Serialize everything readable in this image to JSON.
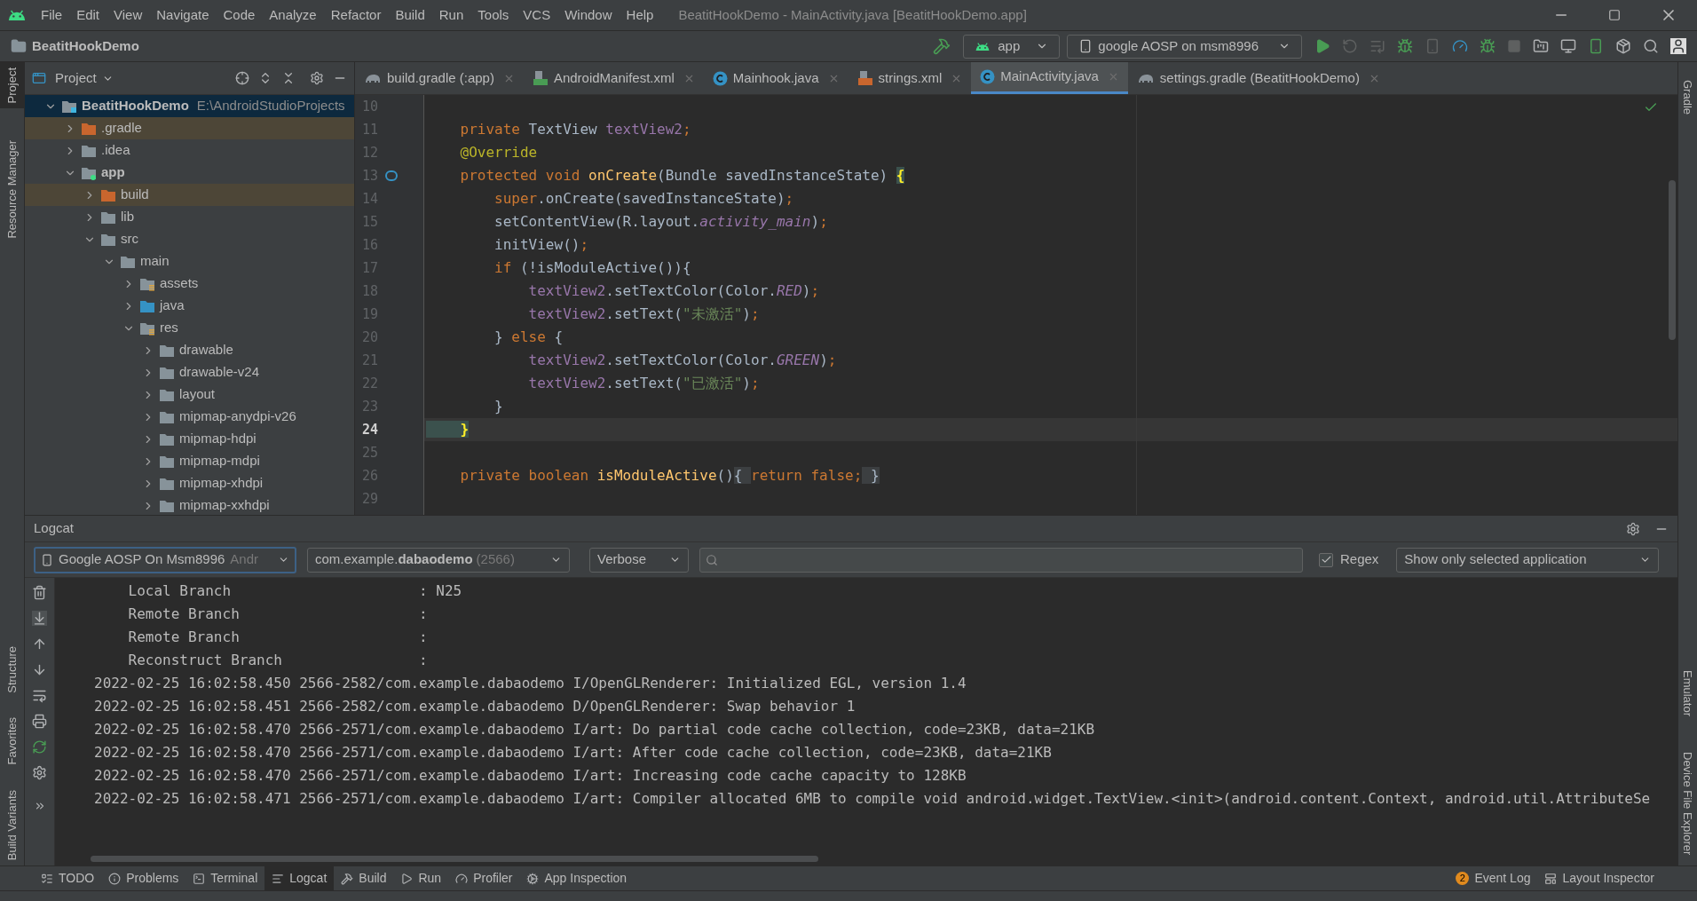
{
  "window": {
    "title": "BeatitHookDemo - MainActivity.java [BeatitHookDemo.app]"
  },
  "menu": [
    "File",
    "Edit",
    "View",
    "Navigate",
    "Code",
    "Analyze",
    "Refactor",
    "Build",
    "Run",
    "Tools",
    "VCS",
    "Window",
    "Help"
  ],
  "nav": {
    "project": "BeatitHookDemo",
    "run_config": "app",
    "device": "google AOSP on msm8996"
  },
  "left_strip": [
    {
      "label": "Project",
      "selected": true
    },
    {
      "label": "Resource Manager",
      "selected": false
    },
    {
      "label": "Structure",
      "selected": false
    },
    {
      "label": "Favorites",
      "selected": false
    },
    {
      "label": "Build Variants",
      "selected": false
    }
  ],
  "right_strip": [
    "Gradle",
    "Emulator",
    "Device File Explorer"
  ],
  "project_panel": {
    "title": "Project",
    "tree": [
      {
        "name": "BeatitHookDemo",
        "path": "E:\\AndroidStudioProjects",
        "kind": "root",
        "expanded": true,
        "selected": true,
        "children": [
          {
            "name": ".gradle",
            "kind": "excluded",
            "expanded": false,
            "selected": false
          },
          {
            "name": ".idea",
            "kind": "plain",
            "expanded": false,
            "selected": false
          },
          {
            "name": "app",
            "kind": "module",
            "expanded": true,
            "selected": false,
            "children": [
              {
                "name": "build",
                "kind": "excluded",
                "expanded": false,
                "selected": false
              },
              {
                "name": "lib",
                "kind": "plain",
                "expanded": false,
                "selected": false
              },
              {
                "name": "src",
                "kind": "plain",
                "expanded": true,
                "selected": false,
                "children": [
                  {
                    "name": "main",
                    "kind": "plain",
                    "expanded": true,
                    "selected": false,
                    "children": [
                      {
                        "name": "assets",
                        "kind": "resource",
                        "expanded": false,
                        "selected": false
                      },
                      {
                        "name": "java",
                        "kind": "source",
                        "expanded": false,
                        "selected": false
                      },
                      {
                        "name": "res",
                        "kind": "resource",
                        "expanded": true,
                        "selected": false,
                        "children": [
                          {
                            "name": "drawable",
                            "kind": "plain",
                            "expanded": false,
                            "selected": false
                          },
                          {
                            "name": "drawable-v24",
                            "kind": "plain",
                            "expanded": false,
                            "selected": false
                          },
                          {
                            "name": "layout",
                            "kind": "plain",
                            "expanded": false,
                            "selected": false
                          },
                          {
                            "name": "mipmap-anydpi-v26",
                            "kind": "plain",
                            "expanded": false,
                            "selected": false
                          },
                          {
                            "name": "mipmap-hdpi",
                            "kind": "plain",
                            "expanded": false,
                            "selected": false
                          },
                          {
                            "name": "mipmap-mdpi",
                            "kind": "plain",
                            "expanded": false,
                            "selected": false
                          },
                          {
                            "name": "mipmap-xhdpi",
                            "kind": "plain",
                            "expanded": false,
                            "selected": false
                          },
                          {
                            "name": "mipmap-xxhdpi",
                            "kind": "plain",
                            "expanded": false,
                            "selected": false
                          }
                        ]
                      }
                    ]
                  }
                ]
              }
            ]
          }
        ]
      }
    ]
  },
  "editor_tabs": [
    {
      "label": "build.gradle (:app)",
      "kind": "gradle",
      "selected": false
    },
    {
      "label": "AndroidManifest.xml",
      "kind": "manifest",
      "selected": false
    },
    {
      "label": "Mainhook.java",
      "kind": "class",
      "selected": false
    },
    {
      "label": "strings.xml",
      "kind": "xml",
      "selected": false
    },
    {
      "label": "MainActivity.java",
      "kind": "class",
      "selected": true
    },
    {
      "label": "settings.gradle (BeatitHookDemo)",
      "kind": "gradle",
      "selected": false
    }
  ],
  "code": [
    {
      "number": "10",
      "current": false
    },
    {
      "number": "11",
      "current": false,
      "tokens": [
        {
          "kind": "kw",
          "text": "    private "
        },
        {
          "kind": "plain",
          "text": "TextView "
        },
        {
          "kind": "field",
          "text": "textView2"
        },
        {
          "kind": "kw",
          "text": ";"
        }
      ]
    },
    {
      "number": "12",
      "current": false,
      "tokens": [
        {
          "kind": "anno",
          "text": "    @Override"
        }
      ]
    },
    {
      "number": "13",
      "current": false,
      "tokens": [
        {
          "kind": "kw",
          "text": "    protected void "
        },
        {
          "kind": "method",
          "text": "onCreate"
        },
        {
          "kind": "plain",
          "text": "(Bundle savedInstanceState) "
        },
        {
          "kind": "match",
          "text": "{"
        }
      ]
    },
    {
      "number": "14",
      "current": false,
      "tokens": [
        {
          "kind": "kw",
          "text": "        super"
        },
        {
          "kind": "plain",
          "text": ".onCreate(savedInstanceState)"
        },
        {
          "kind": "kw",
          "text": ";"
        }
      ]
    },
    {
      "number": "15",
      "current": false,
      "tokens": [
        {
          "kind": "plain",
          "text": "        setContentView(R.layout."
        },
        {
          "kind": "static",
          "text": "activity_main"
        },
        {
          "kind": "plain",
          "text": ")"
        },
        {
          "kind": "kw",
          "text": ";"
        }
      ]
    },
    {
      "number": "16",
      "current": false,
      "tokens": [
        {
          "kind": "plain",
          "text": "        initView()"
        },
        {
          "kind": "kw",
          "text": ";"
        }
      ]
    },
    {
      "number": "17",
      "current": false,
      "tokens": [
        {
          "kind": "kw",
          "text": "        if "
        },
        {
          "kind": "plain",
          "text": "(!isModuleActive()){"
        }
      ]
    },
    {
      "number": "18",
      "current": false,
      "tokens": [
        {
          "kind": "field",
          "text": "            textView2"
        },
        {
          "kind": "plain",
          "text": ".setTextColor(Color."
        },
        {
          "kind": "static",
          "text": "RED"
        },
        {
          "kind": "plain",
          "text": ")"
        },
        {
          "kind": "kw",
          "text": ";"
        }
      ]
    },
    {
      "number": "19",
      "current": false,
      "tokens": [
        {
          "kind": "field",
          "text": "            textView2"
        },
        {
          "kind": "plain",
          "text": ".setText("
        },
        {
          "kind": "str",
          "text": "\"未激活\""
        },
        {
          "kind": "plain",
          "text": ")"
        },
        {
          "kind": "kw",
          "text": ";"
        }
      ]
    },
    {
      "number": "20",
      "current": false,
      "tokens": [
        {
          "kind": "plain",
          "text": "        } "
        },
        {
          "kind": "kw",
          "text": "else "
        },
        {
          "kind": "plain",
          "text": "{"
        }
      ]
    },
    {
      "number": "21",
      "current": false,
      "tokens": [
        {
          "kind": "field",
          "text": "            textView2"
        },
        {
          "kind": "plain",
          "text": ".setTextColor(Color."
        },
        {
          "kind": "static",
          "text": "GREEN"
        },
        {
          "kind": "plain",
          "text": ")"
        },
        {
          "kind": "kw",
          "text": ";"
        }
      ]
    },
    {
      "number": "22",
      "current": false,
      "tokens": [
        {
          "kind": "field",
          "text": "            textView2"
        },
        {
          "kind": "plain",
          "text": ".setText("
        },
        {
          "kind": "str",
          "text": "\"已激活\""
        },
        {
          "kind": "plain",
          "text": ")"
        },
        {
          "kind": "kw",
          "text": ";"
        }
      ]
    },
    {
      "number": "23",
      "current": false,
      "tokens": [
        {
          "kind": "plain",
          "text": "        }"
        }
      ]
    },
    {
      "number": "24",
      "current": true,
      "tokens": [
        {
          "kind": "match",
          "text": "    }"
        }
      ]
    },
    {
      "number": "25",
      "current": false
    },
    {
      "number": "26",
      "current": false,
      "tokens": [
        {
          "kind": "kw",
          "text": "    private boolean "
        },
        {
          "kind": "method",
          "text": "isModuleActive"
        },
        {
          "kind": "plain",
          "text": "()"
        },
        {
          "kind": "fold",
          "text": "{ "
        },
        {
          "kind": "kw",
          "text": "return false;"
        },
        {
          "kind": "fold",
          "text": " }"
        }
      ]
    },
    {
      "number": "29",
      "current": false
    }
  ],
  "logcat": {
    "title": "Logcat",
    "device": "Google AOSP On Msm8996",
    "device_suffix": "Andr",
    "package": "com.example.",
    "package_bold": "dabaodemo",
    "pid": "(2566)",
    "level": "Verbose",
    "regex": {
      "label": "Regex",
      "checked": true
    },
    "filter": "Show only selected application",
    "lines": [
      "    Local Branch                      : N25",
      "    Remote Branch                     :",
      "    Remote Branch                     :",
      "    Reconstruct Branch                :",
      "2022-02-25 16:02:58.450 2566-2582/com.example.dabaodemo I/OpenGLRenderer: Initialized EGL, version 1.4",
      "2022-02-25 16:02:58.451 2566-2582/com.example.dabaodemo D/OpenGLRenderer: Swap behavior 1",
      "2022-02-25 16:02:58.470 2566-2571/com.example.dabaodemo I/art: Do partial code cache collection, code=23KB, data=21KB",
      "2022-02-25 16:02:58.470 2566-2571/com.example.dabaodemo I/art: After code cache collection, code=23KB, data=21KB",
      "2022-02-25 16:02:58.470 2566-2571/com.example.dabaodemo I/art: Increasing code cache capacity to 128KB",
      "2022-02-25 16:02:58.471 2566-2571/com.example.dabaodemo I/art: Compiler allocated 6MB to compile void android.widget.TextView.<init>(android.content.Context, android.util.AttributeSe"
    ]
  },
  "bottom_tools": [
    {
      "label": "TODO",
      "kind": "list",
      "selected": false
    },
    {
      "label": "Problems",
      "kind": "problems",
      "selected": false
    },
    {
      "label": "Terminal",
      "kind": "terminal",
      "selected": false
    },
    {
      "label": "Logcat",
      "kind": "logcat",
      "selected": true
    },
    {
      "label": "Build",
      "kind": "build",
      "selected": false
    },
    {
      "label": "Run",
      "kind": "run",
      "selected": false
    },
    {
      "label": "Profiler",
      "kind": "profiler",
      "selected": false
    },
    {
      "label": "App Inspection",
      "kind": "inspection",
      "selected": false
    }
  ],
  "event_log": {
    "label": "Event Log",
    "count": "2"
  },
  "layout_inspector": "Layout Inspector"
}
